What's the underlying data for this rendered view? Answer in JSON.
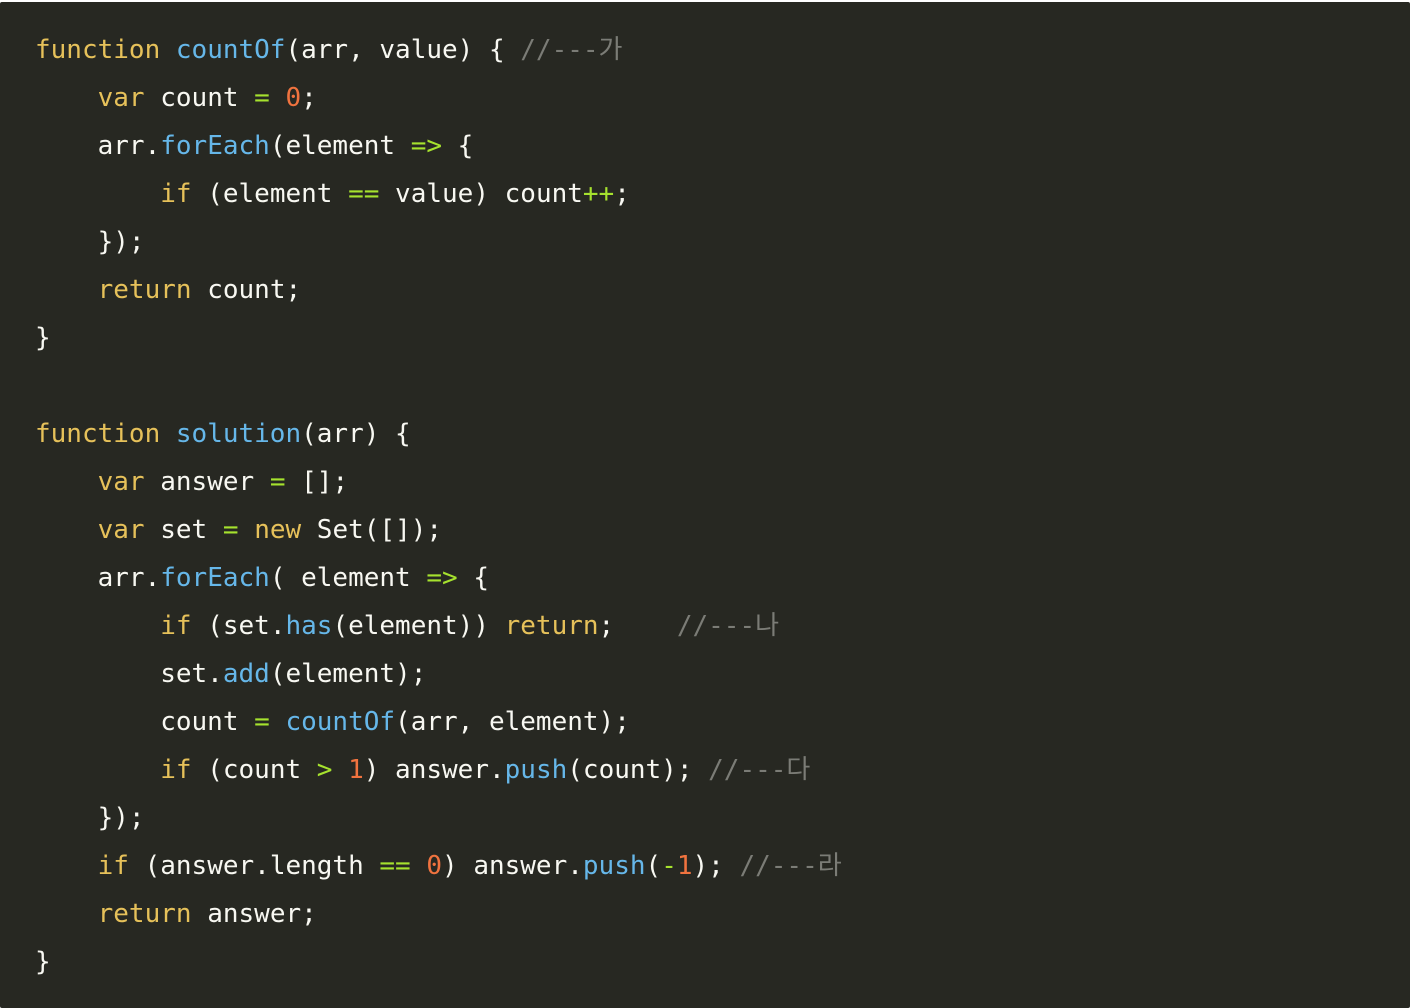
{
  "colors": {
    "background": "#272822",
    "keyword": "#e6c15a",
    "function": "#66b7e9",
    "operator": "#a6e22e",
    "number": "#f0733f",
    "comment": "#7b7c76",
    "text": "#f8f8f2"
  },
  "code": {
    "lines": [
      [
        {
          "text": "function",
          "type": "key"
        },
        {
          "text": " ",
          "type": "id"
        },
        {
          "text": "countOf",
          "type": "fn"
        },
        {
          "text": "(arr, value) { ",
          "type": "id"
        },
        {
          "text": "//---가",
          "type": "cm"
        }
      ],
      [
        {
          "text": "    ",
          "type": "id"
        },
        {
          "text": "var",
          "type": "key"
        },
        {
          "text": " count ",
          "type": "id"
        },
        {
          "text": "=",
          "type": "op"
        },
        {
          "text": " ",
          "type": "id"
        },
        {
          "text": "0",
          "type": "num"
        },
        {
          "text": ";",
          "type": "id"
        }
      ],
      [
        {
          "text": "    arr.",
          "type": "id"
        },
        {
          "text": "forEach",
          "type": "fn"
        },
        {
          "text": "(element ",
          "type": "id"
        },
        {
          "text": "=>",
          "type": "op"
        },
        {
          "text": " {",
          "type": "id"
        }
      ],
      [
        {
          "text": "        ",
          "type": "id"
        },
        {
          "text": "if",
          "type": "key"
        },
        {
          "text": " (element ",
          "type": "id"
        },
        {
          "text": "==",
          "type": "op"
        },
        {
          "text": " value) count",
          "type": "id"
        },
        {
          "text": "++",
          "type": "op"
        },
        {
          "text": ";",
          "type": "id"
        }
      ],
      [
        {
          "text": "    });",
          "type": "id"
        }
      ],
      [
        {
          "text": "    ",
          "type": "id"
        },
        {
          "text": "return",
          "type": "key"
        },
        {
          "text": " count;",
          "type": "id"
        }
      ],
      [
        {
          "text": "}",
          "type": "id"
        }
      ],
      [
        {
          "text": "",
          "type": "id"
        }
      ],
      [
        {
          "text": "function",
          "type": "key"
        },
        {
          "text": " ",
          "type": "id"
        },
        {
          "text": "solution",
          "type": "fn"
        },
        {
          "text": "(arr) {",
          "type": "id"
        }
      ],
      [
        {
          "text": "    ",
          "type": "id"
        },
        {
          "text": "var",
          "type": "key"
        },
        {
          "text": " answer ",
          "type": "id"
        },
        {
          "text": "=",
          "type": "op"
        },
        {
          "text": " [];",
          "type": "id"
        }
      ],
      [
        {
          "text": "    ",
          "type": "id"
        },
        {
          "text": "var",
          "type": "key"
        },
        {
          "text": " set ",
          "type": "id"
        },
        {
          "text": "=",
          "type": "op"
        },
        {
          "text": " ",
          "type": "id"
        },
        {
          "text": "new",
          "type": "key"
        },
        {
          "text": " Set([]);",
          "type": "id"
        }
      ],
      [
        {
          "text": "    arr.",
          "type": "id"
        },
        {
          "text": "forEach",
          "type": "fn"
        },
        {
          "text": "( element ",
          "type": "id"
        },
        {
          "text": "=>",
          "type": "op"
        },
        {
          "text": " {",
          "type": "id"
        }
      ],
      [
        {
          "text": "        ",
          "type": "id"
        },
        {
          "text": "if",
          "type": "key"
        },
        {
          "text": " (set.",
          "type": "id"
        },
        {
          "text": "has",
          "type": "fn"
        },
        {
          "text": "(element)) ",
          "type": "id"
        },
        {
          "text": "return",
          "type": "key"
        },
        {
          "text": ";    ",
          "type": "id"
        },
        {
          "text": "//---나",
          "type": "cm"
        }
      ],
      [
        {
          "text": "        set.",
          "type": "id"
        },
        {
          "text": "add",
          "type": "fn"
        },
        {
          "text": "(element);",
          "type": "id"
        }
      ],
      [
        {
          "text": "        count ",
          "type": "id"
        },
        {
          "text": "=",
          "type": "op"
        },
        {
          "text": " ",
          "type": "id"
        },
        {
          "text": "countOf",
          "type": "fn"
        },
        {
          "text": "(arr, element);",
          "type": "id"
        }
      ],
      [
        {
          "text": "        ",
          "type": "id"
        },
        {
          "text": "if",
          "type": "key"
        },
        {
          "text": " (count ",
          "type": "id"
        },
        {
          "text": ">",
          "type": "op"
        },
        {
          "text": " ",
          "type": "id"
        },
        {
          "text": "1",
          "type": "num"
        },
        {
          "text": ") answer.",
          "type": "id"
        },
        {
          "text": "push",
          "type": "fn"
        },
        {
          "text": "(count); ",
          "type": "id"
        },
        {
          "text": "//---다",
          "type": "cm"
        }
      ],
      [
        {
          "text": "    });",
          "type": "id"
        }
      ],
      [
        {
          "text": "    ",
          "type": "id"
        },
        {
          "text": "if",
          "type": "key"
        },
        {
          "text": " (answer.length ",
          "type": "id"
        },
        {
          "text": "==",
          "type": "op"
        },
        {
          "text": " ",
          "type": "id"
        },
        {
          "text": "0",
          "type": "num"
        },
        {
          "text": ") answer.",
          "type": "id"
        },
        {
          "text": "push",
          "type": "fn"
        },
        {
          "text": "(",
          "type": "id"
        },
        {
          "text": "-",
          "type": "op"
        },
        {
          "text": "1",
          "type": "num"
        },
        {
          "text": "); ",
          "type": "id"
        },
        {
          "text": "//---라",
          "type": "cm"
        }
      ],
      [
        {
          "text": "    ",
          "type": "id"
        },
        {
          "text": "return",
          "type": "key"
        },
        {
          "text": " answer;",
          "type": "id"
        }
      ],
      [
        {
          "text": "}",
          "type": "id"
        }
      ]
    ]
  }
}
